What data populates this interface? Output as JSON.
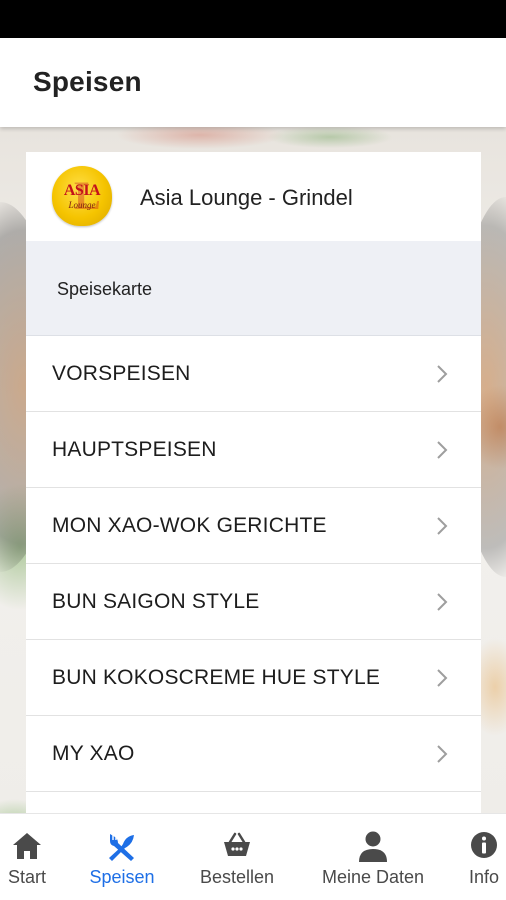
{
  "app_bar": {
    "title": "Speisen"
  },
  "restaurant": {
    "name": "Asia Lounge - Grindel",
    "logo_text": "ASIA",
    "logo_subtext": "Lounge"
  },
  "section": {
    "title": "Speisekarte"
  },
  "menu_items": [
    {
      "label": "VORSPEISEN",
      "icon": "chevron-right-icon"
    },
    {
      "label": "HAUPTSPEISEN",
      "icon": "chevron-right-icon"
    },
    {
      "label": "MON XAO-WOK GERICHTE",
      "icon": "chevron-right-icon"
    },
    {
      "label": "BUN SAIGON STYLE",
      "icon": "chevron-right-icon"
    },
    {
      "label": "BUN KOKOSCREME HUE STYLE",
      "icon": "chevron-right-icon"
    },
    {
      "label": "MY XAO",
      "icon": "chevron-right-icon"
    }
  ],
  "bottom_nav": {
    "active": "Speisen",
    "items": [
      {
        "label": "Start",
        "icon": "home-icon"
      },
      {
        "label": "Speisen",
        "icon": "utensils-icon"
      },
      {
        "label": "Bestellen",
        "icon": "basket-icon"
      },
      {
        "label": "Meine Daten",
        "icon": "person-icon"
      },
      {
        "label": "Info",
        "icon": "info-icon"
      }
    ]
  },
  "colors": {
    "accent": "#1e6fe6",
    "nav_inactive": "#4a4a4a",
    "subheader_bg": "#eef0f5",
    "logo_yellow": "#f5c400",
    "logo_red": "#c4121a"
  }
}
